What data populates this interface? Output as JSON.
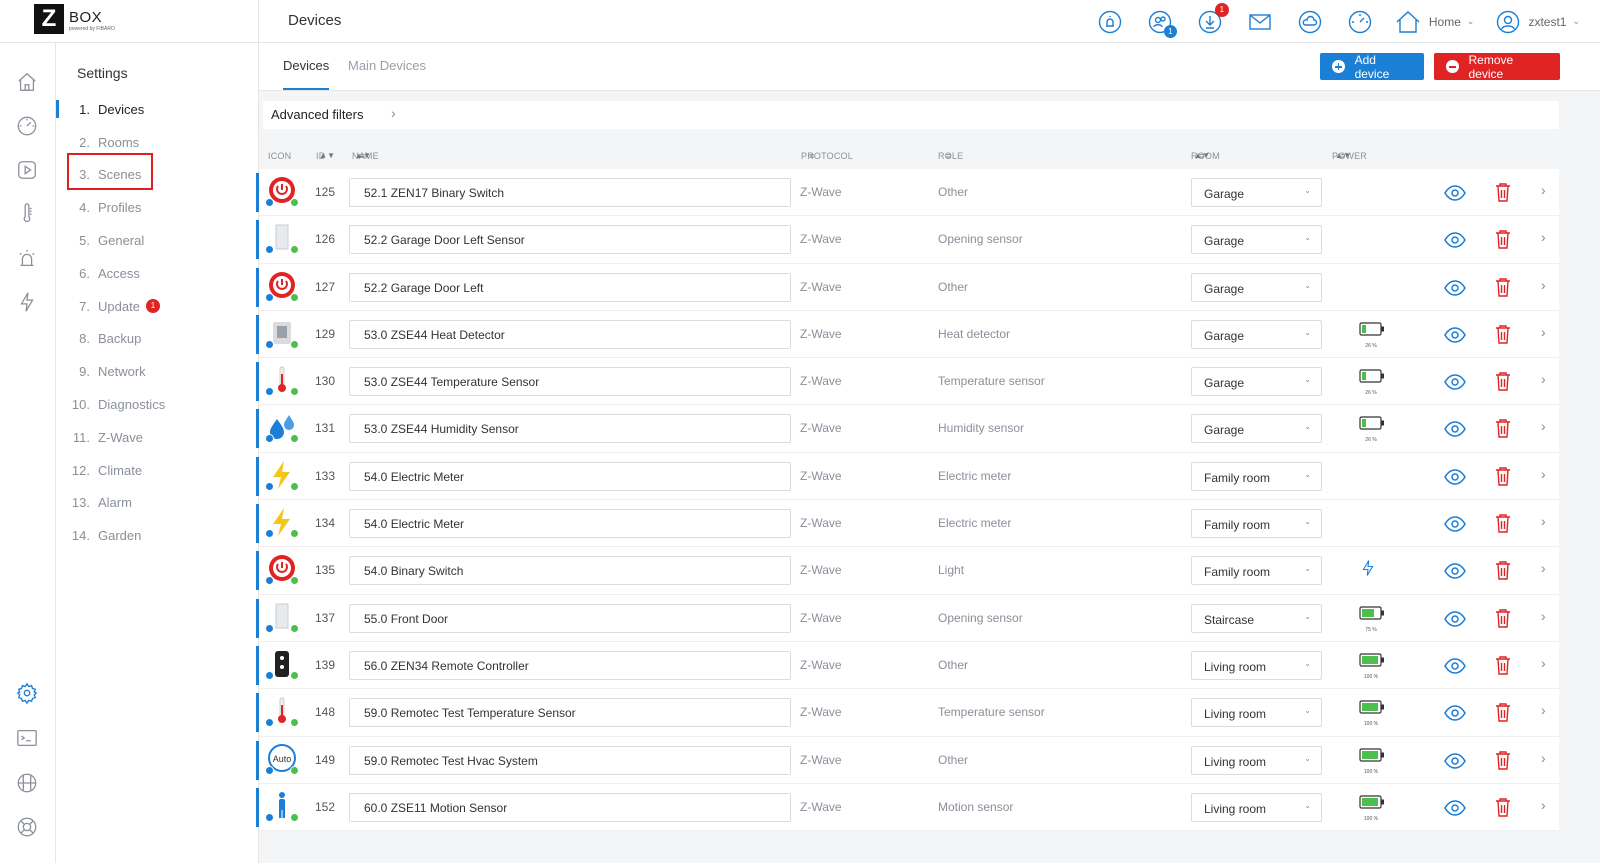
{
  "brand": {
    "logo_letter": "Z",
    "logo_text": "BOX",
    "powered": "powered by FIBARO"
  },
  "header": {
    "title": "Devices",
    "notification_badge": "1",
    "users_badge": "1",
    "home_label": "Home",
    "user_label": "zxtest1"
  },
  "settings": {
    "title": "Settings",
    "items": [
      {
        "num": "1.",
        "label": "Devices"
      },
      {
        "num": "2.",
        "label": "Rooms"
      },
      {
        "num": "3.",
        "label": "Scenes"
      },
      {
        "num": "4.",
        "label": "Profiles"
      },
      {
        "num": "5.",
        "label": "General"
      },
      {
        "num": "6.",
        "label": "Access"
      },
      {
        "num": "7.",
        "label": "Update"
      },
      {
        "num": "8.",
        "label": "Backup"
      },
      {
        "num": "9.",
        "label": "Network"
      },
      {
        "num": "10.",
        "label": "Diagnostics"
      },
      {
        "num": "11.",
        "label": "Z-Wave"
      },
      {
        "num": "12.",
        "label": "Climate"
      },
      {
        "num": "13.",
        "label": "Alarm"
      },
      {
        "num": "14.",
        "label": "Garden"
      }
    ],
    "update_badge": "1"
  },
  "tabs": {
    "devices": "Devices",
    "main_devices": "Main Devices"
  },
  "actions": {
    "add": "Add device",
    "remove": "Remove device"
  },
  "filters": {
    "label": "Advanced filters"
  },
  "columns": {
    "icon": "ICON",
    "id": "ID",
    "name": "NAME",
    "protocol": "PROTOCOL",
    "role": "ROLE",
    "room": "ROOM",
    "power": "POWER"
  },
  "devices": [
    {
      "icon": "switch",
      "id": "125",
      "name": "52.1 ZEN17 Binary Switch",
      "protocol": "Z-Wave",
      "role": "Other",
      "room": "Garage",
      "power": null
    },
    {
      "icon": "door",
      "id": "126",
      "name": "52.2 Garage Door Left Sensor",
      "protocol": "Z-Wave",
      "role": "Opening sensor",
      "room": "Garage",
      "power": null
    },
    {
      "icon": "switch",
      "id": "127",
      "name": "52.2 Garage Door Left",
      "protocol": "Z-Wave",
      "role": "Other",
      "room": "Garage",
      "power": null
    },
    {
      "icon": "heat",
      "id": "129",
      "name": "53.0 ZSE44 Heat Detector",
      "protocol": "Z-Wave",
      "role": "Heat detector",
      "room": "Garage",
      "power": "26 %",
      "battery": 26
    },
    {
      "icon": "thermo",
      "id": "130",
      "name": "53.0 ZSE44 Temperature Sensor",
      "protocol": "Z-Wave",
      "role": "Temperature sensor",
      "room": "Garage",
      "power": "26 %",
      "battery": 26
    },
    {
      "icon": "humidity",
      "id": "131",
      "name": "53.0 ZSE44 Humidity Sensor",
      "protocol": "Z-Wave",
      "role": "Humidity sensor",
      "room": "Garage",
      "power": "26 %",
      "battery": 26
    },
    {
      "icon": "bolt",
      "id": "133",
      "name": "54.0 Electric Meter",
      "protocol": "Z-Wave",
      "role": "Electric meter",
      "room": "Family room",
      "power": null
    },
    {
      "icon": "bolt",
      "id": "134",
      "name": "54.0 Electric Meter",
      "protocol": "Z-Wave",
      "role": "Electric meter",
      "room": "Family room",
      "power": null
    },
    {
      "icon": "switch",
      "id": "135",
      "name": "54.0 Binary Switch",
      "protocol": "Z-Wave",
      "role": "Light",
      "room": "Family room",
      "power": "mains"
    },
    {
      "icon": "door",
      "id": "137",
      "name": "55.0 Front Door",
      "protocol": "Z-Wave",
      "role": "Opening sensor",
      "room": "Staircase",
      "power": "75 %",
      "battery": 75
    },
    {
      "icon": "remote",
      "id": "139",
      "name": "56.0 ZEN34 Remote Controller",
      "protocol": "Z-Wave",
      "role": "Other",
      "room": "Living room",
      "power": "100 %",
      "battery": 100
    },
    {
      "icon": "thermo",
      "id": "148",
      "name": "59.0 Remotec Test Temperature Sensor",
      "protocol": "Z-Wave",
      "role": "Temperature sensor",
      "room": "Living room",
      "power": "100 %",
      "battery": 100
    },
    {
      "icon": "hvac",
      "id": "149",
      "name": "59.0 Remotec Test Hvac System",
      "protocol": "Z-Wave",
      "role": "Other",
      "room": "Living room",
      "power": "100 %",
      "battery": 100
    },
    {
      "icon": "motion",
      "id": "152",
      "name": "60.0 ZSE11 Motion Sensor",
      "protocol": "Z-Wave",
      "role": "Motion sensor",
      "room": "Living room",
      "power": "100 %",
      "battery": 100
    }
  ],
  "colors": {
    "accent": "#1b7fd6",
    "danger": "#e02424",
    "ok": "#4cc04c"
  }
}
